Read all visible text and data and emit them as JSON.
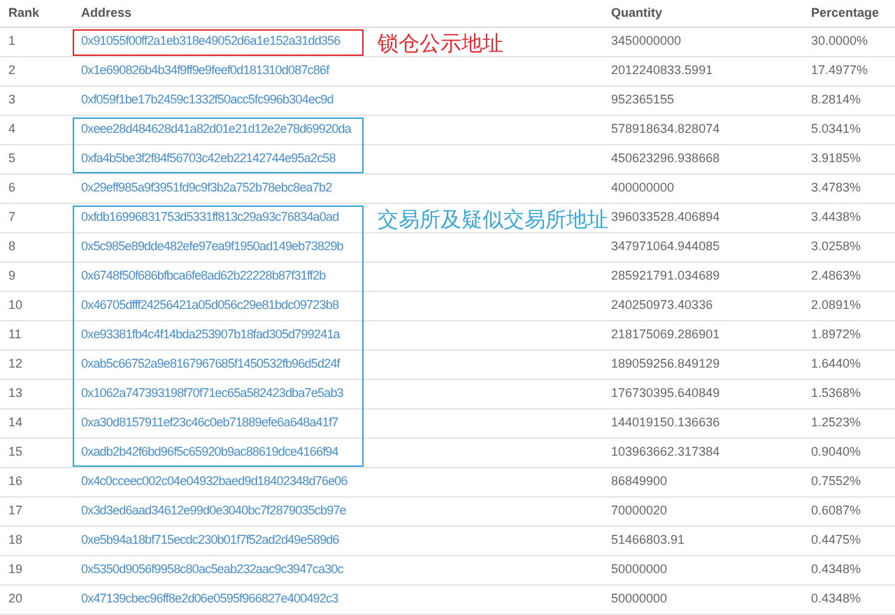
{
  "table": {
    "columns": [
      "Rank",
      "Address",
      "Quantity",
      "Percentage"
    ],
    "groups": [
      {
        "color": "#e0282e",
        "note": "锁仓公示地址",
        "rows": [
          {
            "rank": "1",
            "address": "0x91055f00ff2a1eb318e49052d6a1e152a31dd356",
            "quantity": "3450000000",
            "percentage": "30.0000%"
          }
        ]
      },
      {
        "rows": [
          {
            "rank": "2",
            "address": "0x1e690826b4b34f9ff9e9feef0d181310d087c86f",
            "quantity": "2012240833.5991",
            "percentage": "17.4977%"
          },
          {
            "rank": "3",
            "address": "0xf059f1be17b2459c1332f50acc5fc996b304ec9d",
            "quantity": "952365155",
            "percentage": "8.2814%"
          }
        ]
      },
      {
        "color": "#3aa6d8",
        "rows": [
          {
            "rank": "4",
            "address": "0xeee28d484628d41a82d01e21d12e2e78d69920da",
            "quantity": "578918634.828074",
            "percentage": "5.0341%"
          },
          {
            "rank": "5",
            "address": "0xfa4b5be3f2f84f56703c42eb22142744e95a2c58",
            "quantity": "450623296.938668",
            "percentage": "3.9185%"
          }
        ]
      },
      {
        "rows": [
          {
            "rank": "6",
            "address": "0x29eff985a9f3951fd9c9f3b2a752b78ebc8ea7b2",
            "quantity": "400000000",
            "percentage": "3.4783%"
          }
        ]
      },
      {
        "color": "#3aa6d8",
        "note": "交易所及疑似交易所地址",
        "rows": [
          {
            "rank": "7",
            "address": "0xfdb16996831753d5331ff813c29a93c76834a0ad",
            "quantity": "396033528.406894",
            "percentage": "3.4438%"
          },
          {
            "rank": "8",
            "address": "0x5c985e89dde482efe97ea9f1950ad149eb73829b",
            "quantity": "347971064.944085",
            "percentage": "3.0258%"
          },
          {
            "rank": "9",
            "address": "0x6748f50f686bfbca6fe8ad62b22228b87f31ff2b",
            "quantity": "285921791.034689",
            "percentage": "2.4863%"
          },
          {
            "rank": "10",
            "address": "0x46705dfff24256421a05d056c29e81bdc09723b8",
            "quantity": "240250973.40336",
            "percentage": "2.0891%"
          },
          {
            "rank": "11",
            "address": "0xe93381fb4c4f14bda253907b18fad305d799241a",
            "quantity": "218175069.286901",
            "percentage": "1.8972%"
          },
          {
            "rank": "12",
            "address": "0xab5c66752a9e8167967685f1450532fb96d5d24f",
            "quantity": "189059256.849129",
            "percentage": "1.6440%"
          },
          {
            "rank": "13",
            "address": "0x1062a747393198f70f71ec65a582423dba7e5ab3",
            "quantity": "176730395.640849",
            "percentage": "1.5368%"
          },
          {
            "rank": "14",
            "address": "0xa30d8157911ef23c46c0eb71889efe6a648a41f7",
            "quantity": "144019150.136636",
            "percentage": "1.2523%"
          },
          {
            "rank": "15",
            "address": "0xadb2b42f6bd96f5c65920b9ac88619dce4166f94",
            "quantity": "103963662.317384",
            "percentage": "0.9040%"
          }
        ]
      },
      {
        "rows": [
          {
            "rank": "16",
            "address": "0x4c0cceec002c04e04932baed9d18402348d76e06",
            "quantity": "86849900",
            "percentage": "0.7552%"
          },
          {
            "rank": "17",
            "address": "0x3d3ed6aad34612e99d0e3040bc7f2879035cb97e",
            "quantity": "70000020",
            "percentage": "0.6087%"
          },
          {
            "rank": "18",
            "address": "0xe5b94a18bf715ecdc230b01f7f52ad2d49e589d6",
            "quantity": "51466803.91",
            "percentage": "0.4475%"
          },
          {
            "rank": "19",
            "address": "0x5350d9056f9958c80ac5eab232aac9c3947ca30c",
            "quantity": "50000000",
            "percentage": "0.4348%"
          },
          {
            "rank": "20",
            "address": "0x47139cbec96ff8e2d06e0595f966827e400492c3",
            "quantity": "50000000",
            "percentage": "0.4348%"
          }
        ]
      }
    ]
  }
}
